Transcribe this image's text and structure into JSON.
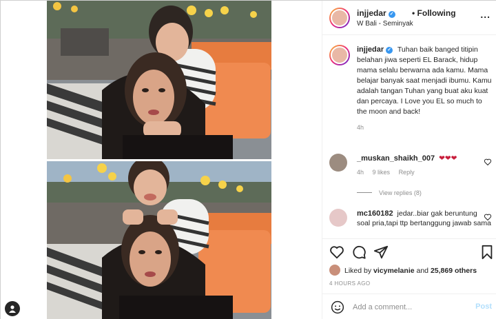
{
  "post": {
    "username": "injjedar",
    "follow_state": "Following",
    "location": "W Bali - Seminyak",
    "more": "...",
    "caption": "Tuhan baik banged titipin belahan jiwa seperti EL Barack, hidup mama selalu berwarna ada kamu. Mama belajar banyak saat menjadi ibumu. Kamu adalah tangan Tuhan yang buat aku kuat dan percaya. I Love you EL so much to the moon and back!",
    "caption_time": "4h"
  },
  "comments": [
    {
      "username": "_muskan_shaikh_007",
      "text": "❤❤❤",
      "time": "4h",
      "likes": "9 likes",
      "reply": "Reply",
      "view_replies": "View replies (8)"
    },
    {
      "username": "mc160182",
      "text": "jedar..biar gak beruntung soal pria,tapi ttp bertanggung jawab sama"
    }
  ],
  "likes": {
    "prefix": "Liked by",
    "user": "vicymelanie",
    "and": "and",
    "others": "25,869 others"
  },
  "post_time": "4 HOURS AGO",
  "add_comment": {
    "placeholder": "Add a comment...",
    "post_label": "Post"
  },
  "colors": {
    "verified": "#3897f0",
    "muted": "#8e8e8e",
    "post_disabled": "#b2dffc",
    "cushion": "#f08a50"
  }
}
